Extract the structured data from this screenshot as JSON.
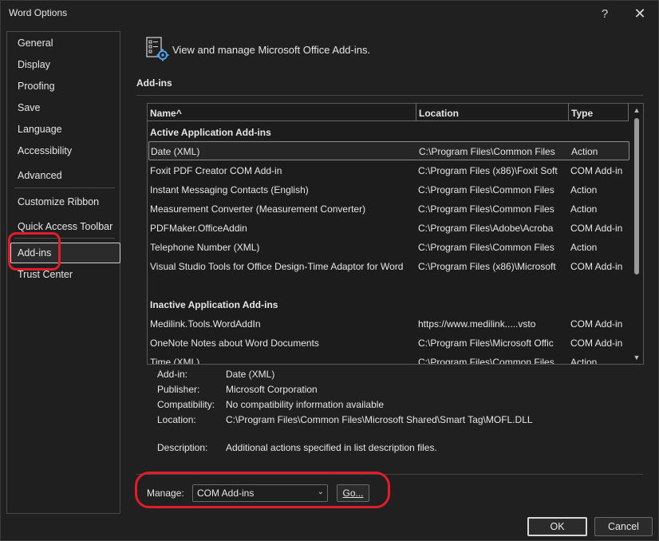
{
  "window": {
    "title": "Word Options",
    "help_glyph": "?",
    "close_glyph": "✕"
  },
  "sidebar": {
    "items": [
      {
        "label": "General"
      },
      {
        "label": "Display"
      },
      {
        "label": "Proofing"
      },
      {
        "label": "Save"
      },
      {
        "label": "Language"
      },
      {
        "label": "Accessibility"
      },
      {
        "label": "Advanced"
      },
      {
        "label": "Customize Ribbon"
      },
      {
        "label": "Quick Access Toolbar"
      },
      {
        "label": "Add-ins"
      },
      {
        "label": "Trust Center"
      }
    ],
    "selected": "Add-ins"
  },
  "header": {
    "text": "View and manage Microsoft Office Add-ins.",
    "icon": "addins-gear-icon"
  },
  "section_title": "Add-ins",
  "list": {
    "columns": [
      {
        "label": "Name",
        "sort_indicator": "^"
      },
      {
        "label": "Location"
      },
      {
        "label": "Type"
      }
    ],
    "rows": [
      {
        "group": "Active Application Add-ins"
      },
      {
        "name": "Date (XML)",
        "location": "C:\\Program Files\\Common Files",
        "type": "Action",
        "selected": true
      },
      {
        "name": "Foxit PDF Creator COM Add-in",
        "location": "C:\\Program Files (x86)\\Foxit Soft",
        "type": "COM Add-in"
      },
      {
        "name": "Instant Messaging Contacts (English)",
        "location": "C:\\Program Files\\Common Files",
        "type": "Action"
      },
      {
        "name": "Measurement Converter (Measurement Converter)",
        "location": "C:\\Program Files\\Common Files",
        "type": "Action"
      },
      {
        "name": "PDFMaker.OfficeAddin",
        "location": "C:\\Program Files\\Adobe\\Acroba",
        "type": "COM Add-in"
      },
      {
        "name": "Telephone Number (XML)",
        "location": "C:\\Program Files\\Common Files",
        "type": "Action"
      },
      {
        "name": "Visual Studio Tools for Office Design-Time Adaptor for Word",
        "location": "C:\\Program Files (x86)\\Microsoft",
        "type": "COM Add-in"
      },
      {
        "blank": true
      },
      {
        "group": "Inactive Application Add-ins"
      },
      {
        "name": "Medilink.Tools.WordAddIn",
        "location": "https://www.medilink.....vsto",
        "type": "COM Add-in"
      },
      {
        "name": "OneNote Notes about Word Documents",
        "location": "C:\\Program Files\\Microsoft Offic",
        "type": "COM Add-in"
      },
      {
        "name": "Time (XML)",
        "location": "C:\\Program Files\\Common Files",
        "type": "Action"
      }
    ]
  },
  "details": {
    "addin_label": "Add-in:",
    "addin_value": "Date (XML)",
    "publisher_label": "Publisher:",
    "publisher_value": "Microsoft Corporation",
    "compat_label": "Compatibility:",
    "compat_value": "No compatibility information available",
    "location_label": "Location:",
    "location_value": "C:\\Program Files\\Common Files\\Microsoft Shared\\Smart Tag\\MOFL.DLL",
    "description_label": "Description:",
    "description_value": "Additional actions specified in list description files."
  },
  "manage": {
    "label": "Manage:",
    "selected": "COM Add-ins",
    "go_label": "Go..."
  },
  "footer": {
    "ok_label": "OK",
    "cancel_label": "Cancel"
  },
  "colors": {
    "highlight": "#e01d2a",
    "background": "#202020"
  }
}
